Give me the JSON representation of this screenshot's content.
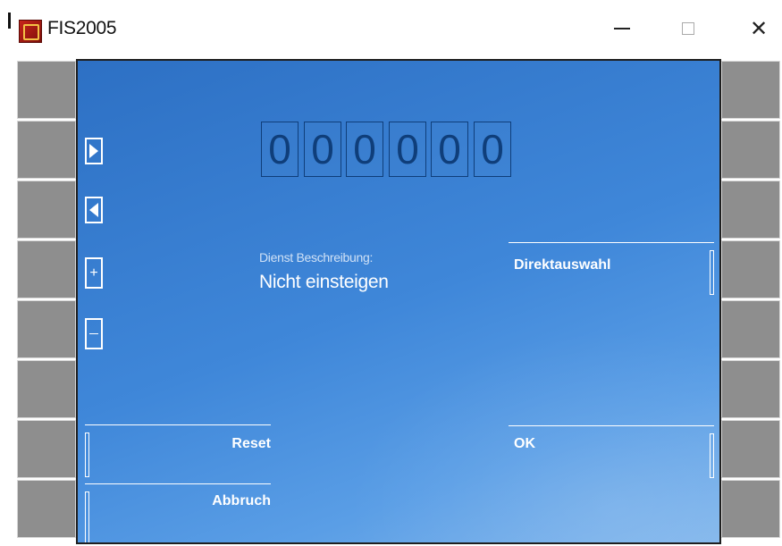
{
  "window": {
    "title": "FIS2005",
    "minimize_icon": "minimize-icon",
    "maximize_icon": "maximize-icon",
    "close_glyph": "✕"
  },
  "counter": {
    "digits": [
      "0",
      "0",
      "0",
      "0",
      "0",
      "0"
    ]
  },
  "service": {
    "label": "Dienst Beschreibung:",
    "value": "Nicht einsteigen"
  },
  "nav": {
    "plus": "+",
    "next_icon": "triangle-right-icon",
    "prev_icon": "triangle-left-icon",
    "minus_icon": "minus-icon"
  },
  "actions": {
    "direktauswahl": "Direktauswahl",
    "ok": "OK",
    "reset": "Reset",
    "abbruch": "Abbruch"
  },
  "colors": {
    "panel_top": "#2d70c4",
    "panel_bottom": "#7fb5ec",
    "side_key": "#8e8e8e",
    "digit": "#0f3e7a"
  }
}
